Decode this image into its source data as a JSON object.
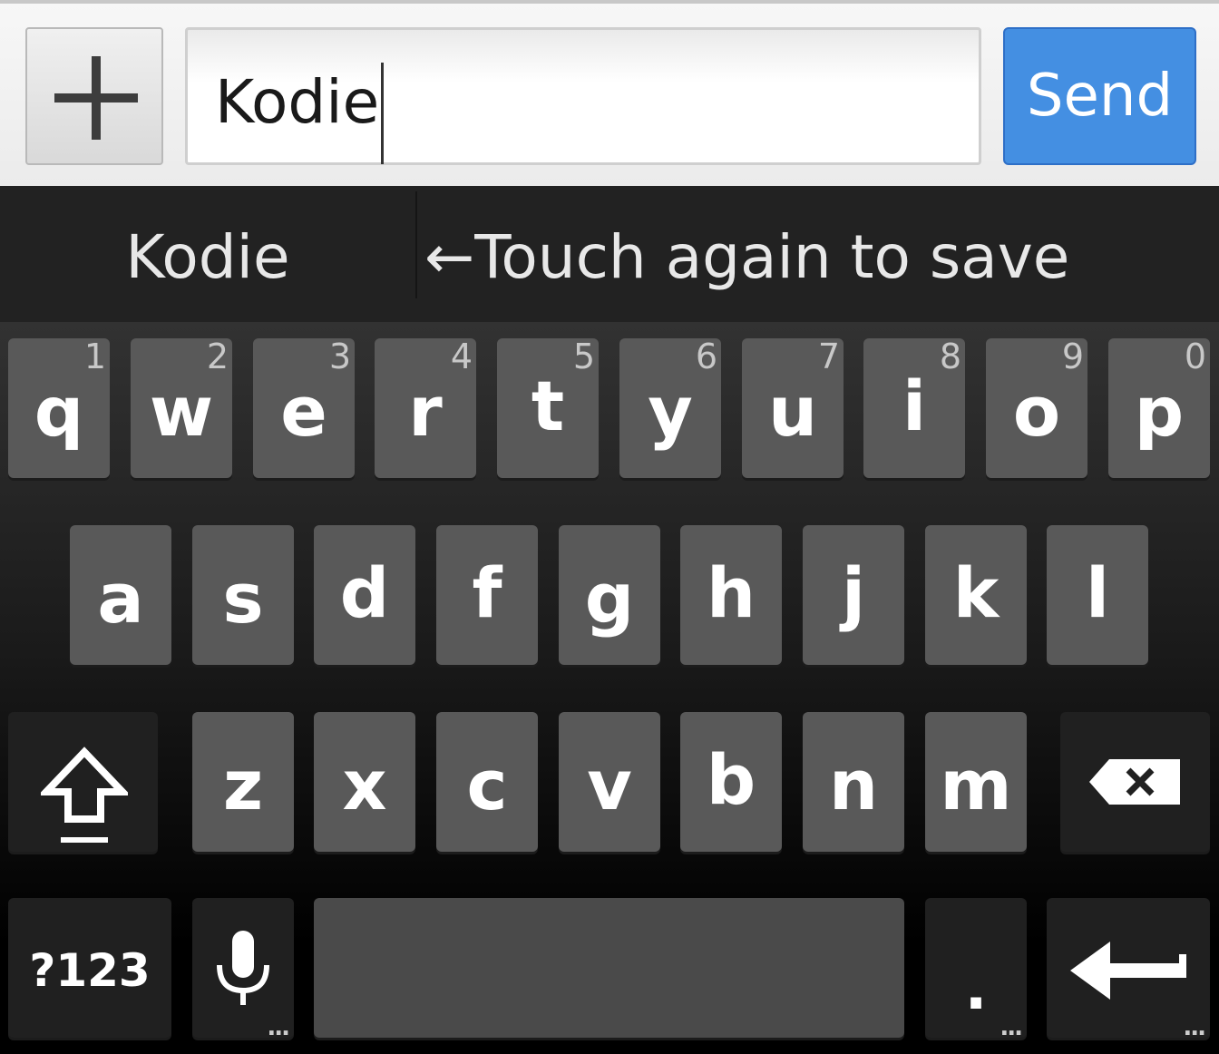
{
  "compose": {
    "attach_icon": "plus-icon",
    "message_text": "Kodie",
    "send_label": "Send",
    "send_color": "#448fe2"
  },
  "suggestions": {
    "word": "Kodie",
    "hint": "←Touch again to save"
  },
  "keyboard": {
    "row1": [
      {
        "key": "q",
        "hint": "1"
      },
      {
        "key": "w",
        "hint": "2"
      },
      {
        "key": "e",
        "hint": "3"
      },
      {
        "key": "r",
        "hint": "4"
      },
      {
        "key": "t",
        "hint": "5"
      },
      {
        "key": "y",
        "hint": "6"
      },
      {
        "key": "u",
        "hint": "7"
      },
      {
        "key": "i",
        "hint": "8"
      },
      {
        "key": "o",
        "hint": "9"
      },
      {
        "key": "p",
        "hint": "0"
      }
    ],
    "row2": [
      "a",
      "s",
      "d",
      "f",
      "g",
      "h",
      "j",
      "k",
      "l"
    ],
    "row3": [
      "z",
      "x",
      "c",
      "v",
      "b",
      "n",
      "m"
    ],
    "shift_icon": "shift-icon",
    "delete_icon": "backspace-icon",
    "symbols_label": "?123",
    "mic_icon": "microphone-icon",
    "period_label": ".",
    "enter_icon": "enter-icon",
    "more_dots": "..."
  }
}
